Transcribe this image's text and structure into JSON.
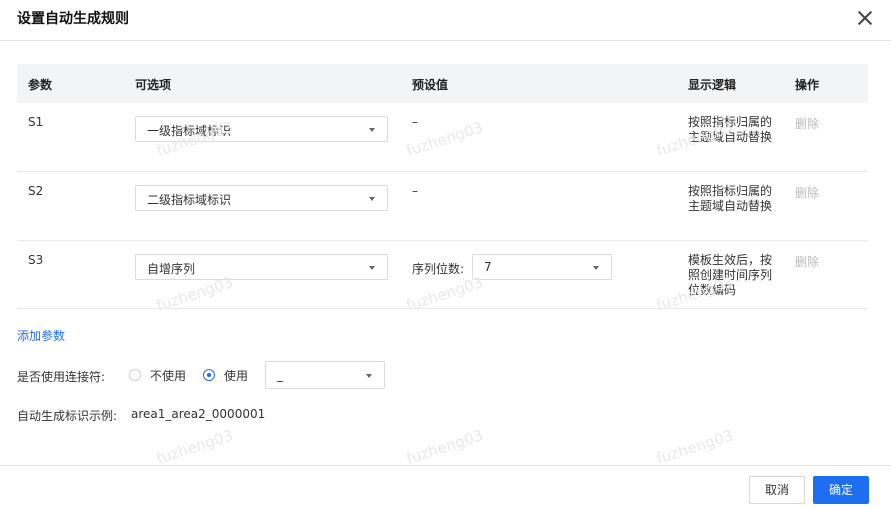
{
  "dialog": {
    "title": "设置自动生成规则"
  },
  "table": {
    "headers": {
      "param": "参数",
      "options": "可选项",
      "preset": "预设值",
      "logic": "显示逻辑",
      "action": "操作"
    },
    "rows": [
      {
        "param": "S1",
        "option": "一级指标域标识",
        "preset": "–",
        "logic": "按照指标归属的主题域自动替换",
        "action": "删除"
      },
      {
        "param": "S2",
        "option": "二级指标域标识",
        "preset": "–",
        "logic": "按照指标归属的主题域自动替换",
        "action": "删除"
      },
      {
        "param": "S3",
        "option": "自增序列",
        "preset_label": "序列位数:",
        "preset_value": "7",
        "logic": "模板生效后，按照创建时间序列位数编码",
        "action": "删除"
      }
    ]
  },
  "add_param": "添加参数",
  "connector": {
    "label": "是否使用连接符:",
    "option_no": "不使用",
    "option_yes": "使用",
    "selected": "使用",
    "symbol": "_"
  },
  "example": {
    "label": "自动生成标识示例:",
    "value": "area1_area2_0000001"
  },
  "footer": {
    "cancel": "取消",
    "confirm": "确定"
  },
  "watermark": "fuzheng03",
  "colors": {
    "accent": "#1d6ef0",
    "header_bg": "#f3f4f6"
  }
}
